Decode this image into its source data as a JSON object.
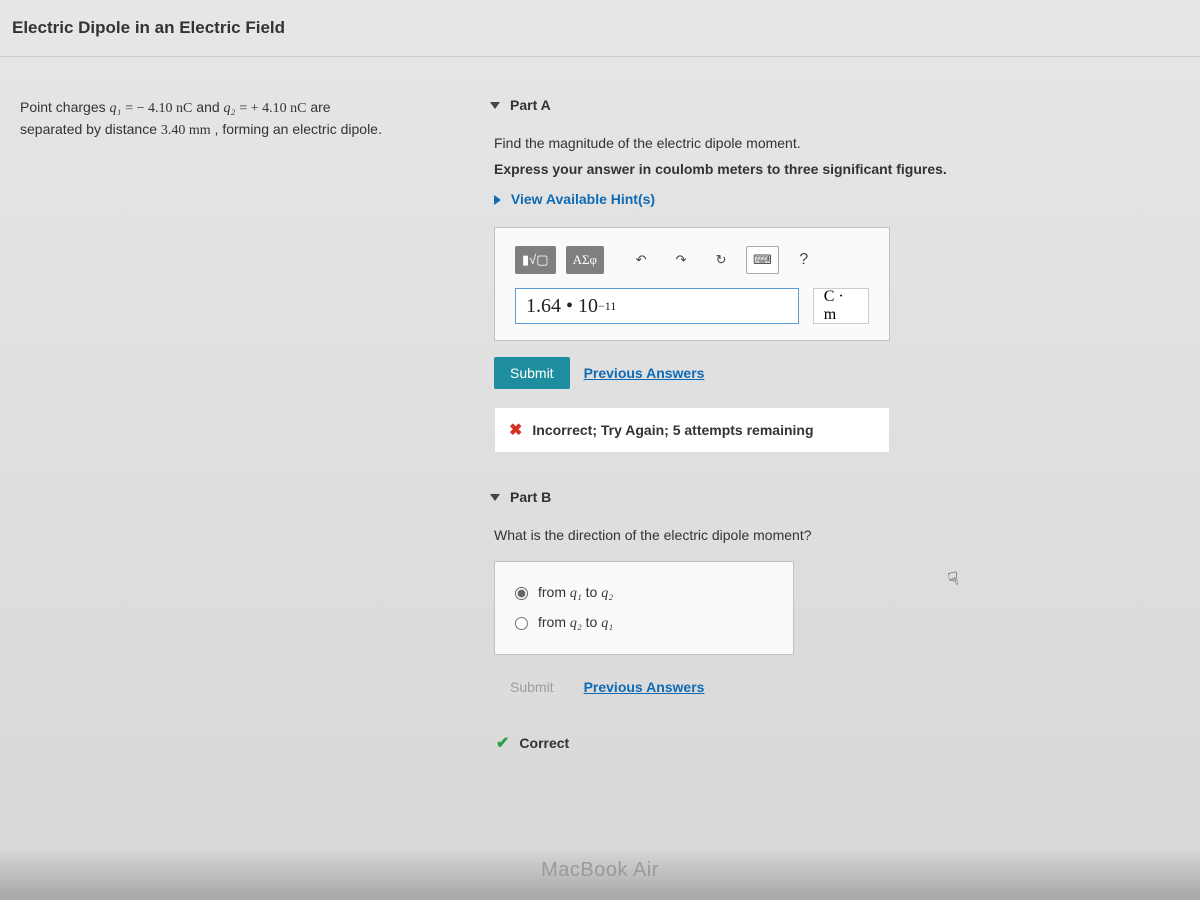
{
  "header": {
    "title": "Electric Dipole in an Electric Field"
  },
  "problem": {
    "line1_prefix": "Point charges ",
    "q1_var": "q₁",
    "q1_eq": " = − 4.10 nC",
    "and": " and ",
    "q2_var": "q₂",
    "q2_eq": " = + 4.10 nC",
    "are": " are",
    "line2_prefix": "separated by distance ",
    "distance": "3.40 mm",
    "line2_suffix": " , forming an electric dipole."
  },
  "partA": {
    "label": "Part A",
    "instruction": "Find the magnitude of the electric dipole moment.",
    "instructionBold": "Express your answer in coulomb meters to three significant figures.",
    "hintsLabel": "View Available Hint(s)",
    "toolbar": {
      "fraction": "▮√▢",
      "symbols": "ΑΣφ",
      "undo": "↶",
      "redo": "↷",
      "reset": "↻",
      "keyboard": "⌨",
      "help": "?"
    },
    "answerValue": "1.64 • 10",
    "answerExp": "−11",
    "unit": "C · m",
    "submit": "Submit",
    "prevAnswers": "Previous Answers",
    "feedback": "Incorrect; Try Again; 5 attempts remaining"
  },
  "partB": {
    "label": "Part B",
    "instruction": "What is the direction of the electric dipole moment?",
    "option1_pre": "from ",
    "option1_a": "q₁",
    "option1_mid": " to ",
    "option1_b": "q₂",
    "option2_pre": "from ",
    "option2_a": "q₂",
    "option2_mid": " to ",
    "option2_b": "q₁",
    "submit": "Submit",
    "prevAnswers": "Previous Answers",
    "feedback": "Correct"
  },
  "device": "MacBook Air"
}
